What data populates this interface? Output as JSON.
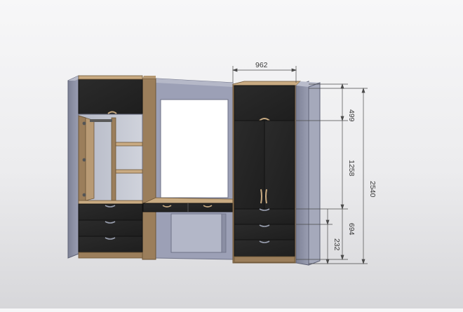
{
  "drawing": {
    "dimensions": {
      "top_width": "962",
      "upper_height": "499",
      "middle_height": "1258",
      "total_height": "2540",
      "lower_height": "694",
      "bottom_drawer_height": "232"
    }
  },
  "colors": {
    "panel_dark": "#262626",
    "panel_side": "#8f93a8",
    "wood": "#9b7e5b",
    "shelf": "#c9ab82",
    "interior": "#c3c6d1",
    "dimension_line": "#4a4a4a"
  }
}
